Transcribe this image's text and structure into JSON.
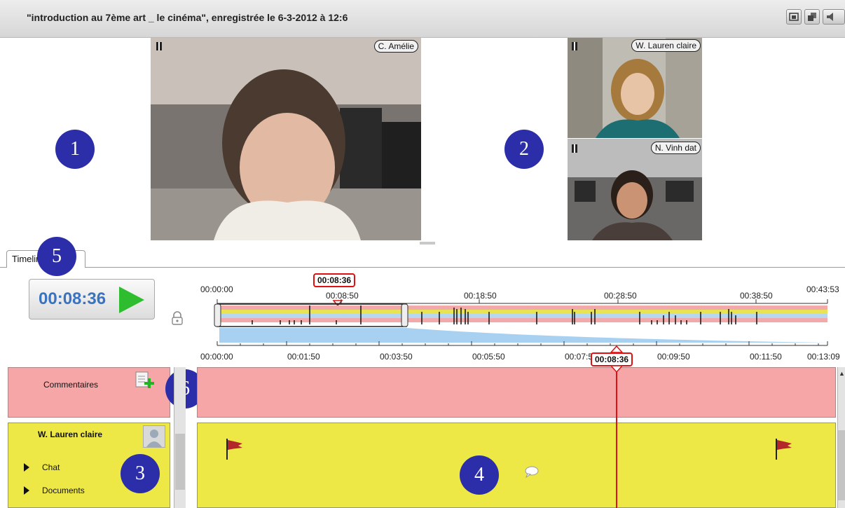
{
  "window": {
    "title": "\"introduction au 7ème art _ le cinéma\", enregistrée le 6-3-2012 à 12:6",
    "buttons": [
      "window-icon",
      "tile-icon",
      "speaker-icon"
    ]
  },
  "videos": [
    {
      "name": "C. Amélie",
      "state_icon": "pause-icon"
    },
    {
      "name": "W. Lauren claire",
      "state_icon": "pause-icon"
    },
    {
      "name": "N. Vinh dat",
      "state_icon": "pause-icon"
    }
  ],
  "callouts": [
    "1",
    "2",
    "3",
    "4",
    "5",
    "6"
  ],
  "tabs": [
    {
      "label": "Timeline"
    }
  ],
  "player": {
    "current_time": "00:08:36",
    "play_icon": "play-icon",
    "lock_icon": "lock-icon"
  },
  "overview_ruler": {
    "labels": [
      "00:00:00",
      "00:08:50",
      "00:18:50",
      "00:28:50",
      "00:38:50",
      "00:43:53"
    ],
    "marker": "00:08:36"
  },
  "detail_ruler": {
    "labels": [
      "00:00:00",
      "00:01:50",
      "00:03:50",
      "00:05:50",
      "00:07:50",
      "00:09:50",
      "00:11:50",
      "00:13:09"
    ],
    "marker": "00:08:36"
  },
  "tracks": {
    "comments": {
      "label": "Commentaires",
      "icon": "add-comment-icon"
    },
    "user": {
      "name": "W. Lauren claire",
      "avatar_icon": "avatar-icon",
      "items": [
        "Chat",
        "Documents"
      ]
    }
  },
  "colors": {
    "comments_track": "#f6a6a6",
    "user_track": "#ede846",
    "callout": "#2b2ea8",
    "marker": "#dd1111",
    "play": "#2ebd2e",
    "time_text": "#3a73bf"
  }
}
